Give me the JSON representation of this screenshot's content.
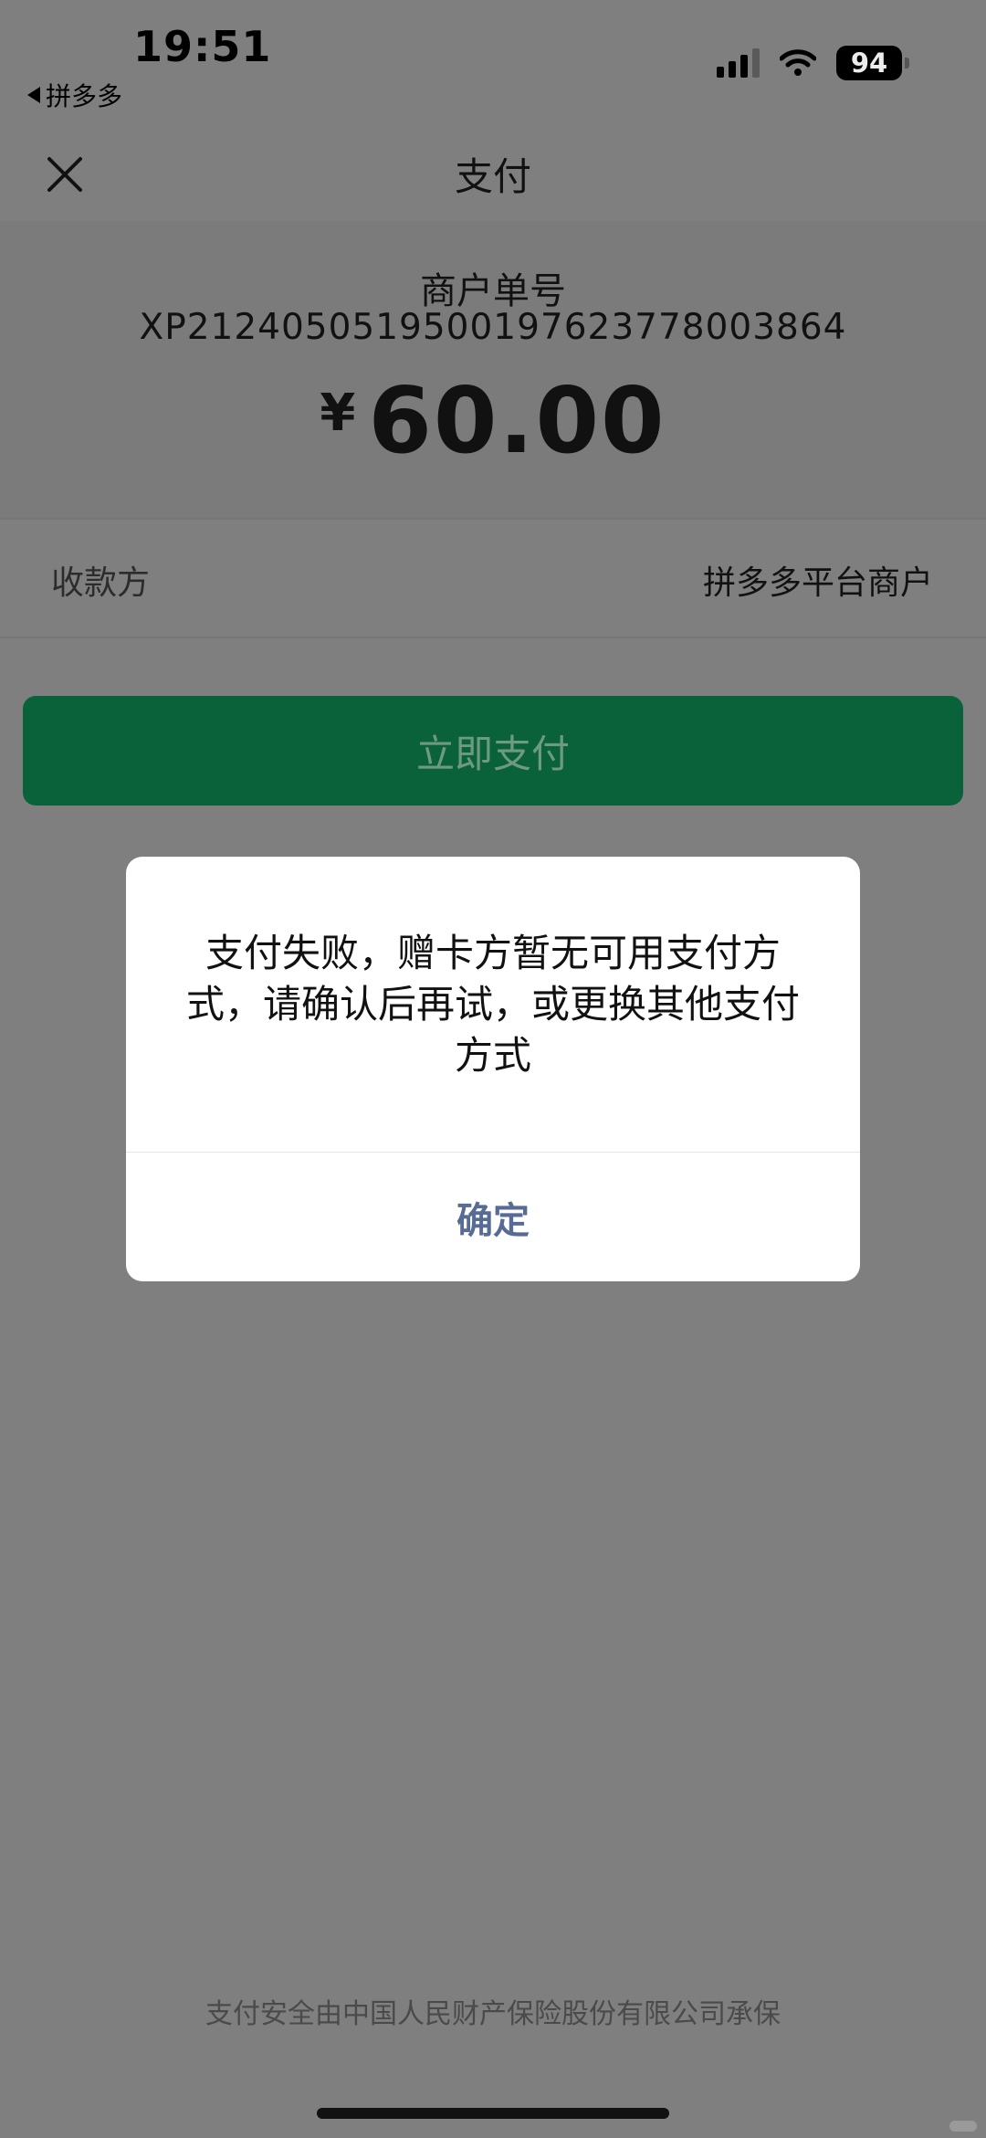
{
  "status_bar": {
    "time": "19:51",
    "back_app": "拼多多",
    "battery": "94"
  },
  "nav": {
    "title": "支付"
  },
  "order": {
    "label": "商户单号",
    "number": "XP212405051950019762377800386­4",
    "currency_symbol": "¥",
    "amount": "60.00"
  },
  "payee": {
    "label": "收款方",
    "value": "拼多多平台商户"
  },
  "pay_button": {
    "label": "立即支付"
  },
  "dialog": {
    "message": "支付失败，赠卡方暂无可用支付方式，请确认后再试，或更换其他支付方式",
    "confirm_label": "确定"
  },
  "footer": {
    "note": "支付安全由中国人民财产保险股份有限公司承保"
  },
  "colors": {
    "pay_button": "#09623a",
    "dialog_confirm": "#576b95",
    "overlay": "#7f7f7f"
  }
}
